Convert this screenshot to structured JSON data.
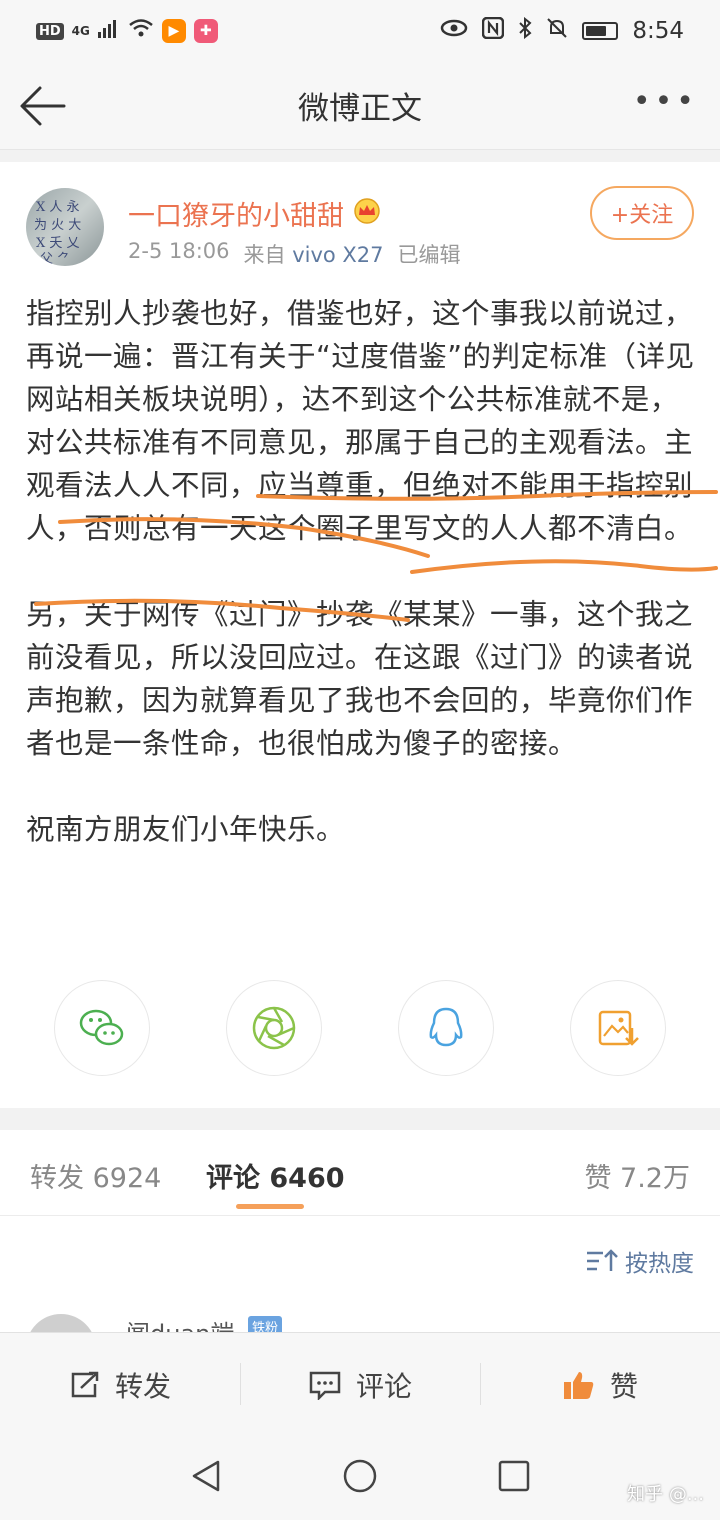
{
  "status_bar": {
    "hd": "HD",
    "network": "4G",
    "time": "8:54",
    "battery_level": 0.7
  },
  "nav": {
    "title": "微博正文",
    "more": "•••"
  },
  "post": {
    "username": "一口獠牙的小甜甜",
    "date": "2-5 18:06",
    "from_label": "来自",
    "device": "vivo X27",
    "edited": "已编辑",
    "follow_label": "+关注",
    "paragraphs": [
      "指控别人抄袭也好，借鉴也好，这个事我以前说过，再说一遍：晋江有关于“过度借鉴”的判定标准（详见网站相关板块说明），达不到这个公共标准就不是，对公共标准有不同意见，那属于自己的主观看法。主观看法人人不同，应当尊重，但绝对不能用于指控别人，否则总有一天这个圈子里写文的人人都不清白。",
      "另，关于网传《过门》抄袭《某某》一事，这个我之前没看见，所以没回应过。在这跟《过门》的读者说声抱歉，因为就算看见了我也不会回的，毕竟你们作者也是一条性命，也很怕成为傻子的密接。",
      "祝南方朋友们小年快乐。"
    ]
  },
  "share": {
    "items": [
      "wechat-icon",
      "moments-icon",
      "qq-icon",
      "save-image-icon"
    ],
    "colors": {
      "wechat": "#4caf50",
      "moments": "#8bc34a",
      "qq": "#4aa3e0",
      "save": "#f0a030"
    }
  },
  "tabs": {
    "repost": "转发 6924",
    "comments": "评论 6460",
    "likes": "赞 7.2万"
  },
  "sort": {
    "label": "按热度"
  },
  "peek_comment": {
    "name": "闻duan端",
    "badge": "铁粉"
  },
  "actions": {
    "repost": "转发",
    "comment": "评论",
    "like": "赞"
  },
  "watermark": "知乎 @...",
  "colors": {
    "accent": "#eb7350",
    "link": "#5f7aa0",
    "scribble": "#f08c3c"
  }
}
